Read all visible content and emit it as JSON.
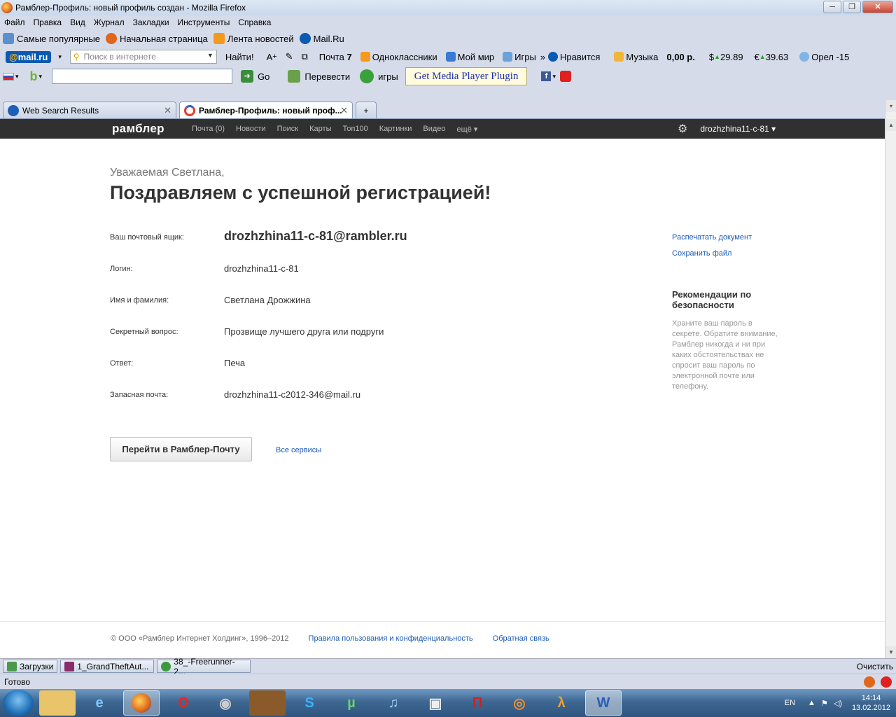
{
  "window": {
    "title": "Рамблер-Профиль: новый профиль создан - Mozilla Firefox",
    "minimize": "─",
    "maximize": "❐",
    "close": "✕"
  },
  "menu": [
    "Файл",
    "Правка",
    "Вид",
    "Журнал",
    "Закладки",
    "Инструменты",
    "Справка"
  ],
  "bookmarks": [
    "Самые популярные",
    "Начальная страница",
    "Лента новостей",
    "Mail.Ru"
  ],
  "mailru_toolbar": {
    "logo_at": "@",
    "logo_text": "mail.ru",
    "search_placeholder": "Поиск в интернете",
    "find_button": "Найти!",
    "mail": "Почта",
    "mail_count": "7",
    "items": [
      "Одноклассники",
      "Мой мир",
      "Игры",
      "»",
      "Нравится",
      "Музыка"
    ],
    "balance": "0,00 р.",
    "usd": "29.89",
    "eur": "39.63",
    "weather": "Орел -15"
  },
  "second_toolbar": {
    "go": "Go",
    "translate": "Перевести",
    "games": "игры",
    "plugin_button": "Get Media Player Plugin"
  },
  "tabs": [
    {
      "label": "Web Search Results",
      "active": false
    },
    {
      "label": "Рамблер-Профиль: новый проф...",
      "active": true
    }
  ],
  "rambler": {
    "logo": "рамблер",
    "nav": [
      "Почта (0)",
      "Новости",
      "Поиск",
      "Карты",
      "Топ100",
      "Картинки",
      "Видео",
      "ещё ▾"
    ],
    "user": "drozhzhina11-c-81 ▾"
  },
  "page": {
    "greeting": "Уважаемая Светлана,",
    "headline": "Поздравляем с успешной регистрацией!",
    "rows": [
      {
        "label": "Ваш почтовый ящик:",
        "value": "drozhzhina11-c-81@rambler.ru"
      },
      {
        "label": "Логин:",
        "value": "drozhzhina11-c-81"
      },
      {
        "label": "Имя и фамилия:",
        "value": "Светлана Дрожжина"
      },
      {
        "label": "Секретный вопрос:",
        "value": "Прозвище лучшего друга или подруги"
      },
      {
        "label": "Ответ:",
        "value": "Печа"
      },
      {
        "label": "Запасная почта:",
        "value": "drozhzhina11-c2012-346@mail.ru"
      }
    ],
    "print_link": "Распечатать документ",
    "save_link": "Сохранить файл",
    "security_title": "Рекомендации по безопасности",
    "security_text": "Храните ваш пароль в секрете. Обратите внимание, Рамблер никогда и ни при каких обстоятельствах не спросит ваш пароль по электронной почте или телефону.",
    "go_button": "Перейти в Рамблер-Почту",
    "all_services": "Все сервисы"
  },
  "footer": {
    "copyright": "© ООО «Рамблер Интернет Холдинг», 1996–2012",
    "terms": "Правила пользования и конфиденциальность",
    "feedback": "Обратная связь"
  },
  "downloads": {
    "label": "Загрузки",
    "items": [
      "1_GrandTheftAut...",
      "38_-Freerunner-2..."
    ],
    "clear": "Очистить"
  },
  "status": "Готово",
  "taskbar": {
    "lang": "EN",
    "time": "14:14",
    "date": "13.02.2012"
  }
}
